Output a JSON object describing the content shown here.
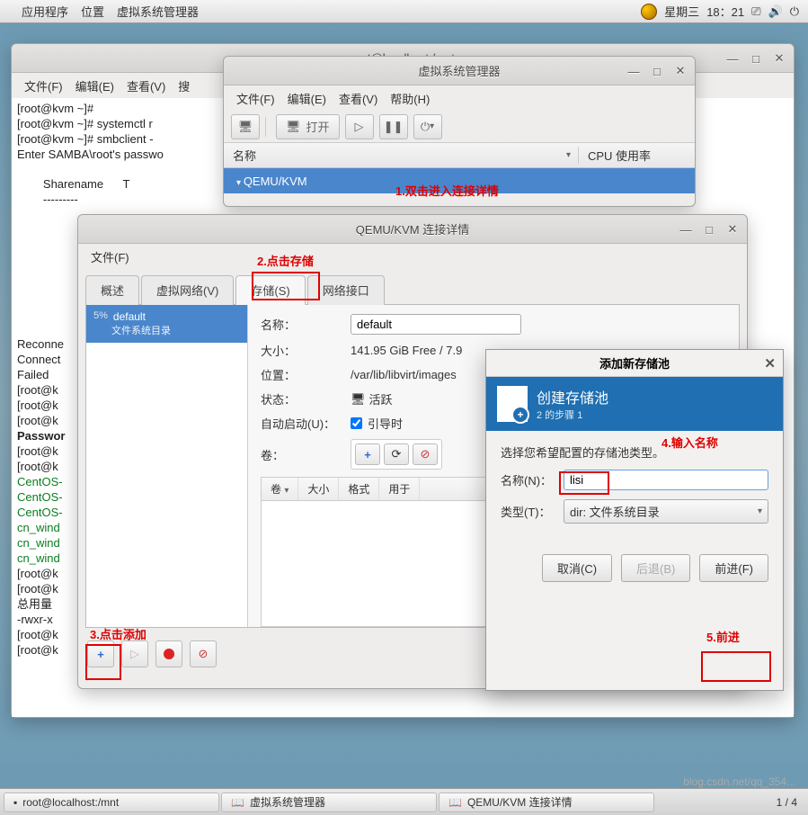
{
  "topbar": {
    "apps": "应用程序",
    "places": "位置",
    "vmm": "虚拟系统管理器",
    "day": "星期三",
    "time": "18：21"
  },
  "terminal": {
    "title": "root@localhost:/mnt",
    "menu": {
      "file": "文件(F)",
      "edit": "编辑(E)",
      "view": "查看(V)",
      "search": "搜"
    },
    "lines": {
      "l1": "[root@kvm ~]#",
      "l2": "[root@kvm ~]# systemctl r",
      "l3": "[root@kvm ~]# smbclient -",
      "l4": "Enter SAMBA\\root's passwo",
      "l5": "        Sharename      T",
      "l6": "        ---------",
      "l7": "Reconne",
      "l8": "Connect",
      "l9": "Failed ",
      "l10": "[root@k",
      "l11": "[root@k",
      "l12": "[root@k",
      "l13": "Passwor",
      "l14": "[root@k",
      "l15": "[root@k",
      "l16": "CentOS-",
      "l17": "CentOS-",
      "l18": "CentOS-",
      "l19": "cn_wind",
      "l20": "cn_wind",
      "l21": "cn_wind",
      "l22": "[root@k",
      "l23": "[root@k",
      "l24": "总用量 ",
      "l25": "-rwxr-x",
      "l26": "[root@k",
      "l27": "[root@k"
    }
  },
  "vmm": {
    "title": "虚拟系统管理器",
    "menu": {
      "file": "文件(F)",
      "edit": "编辑(E)",
      "view": "查看(V)",
      "help": "帮助(H)"
    },
    "open": "打开",
    "col_name": "名称",
    "col_cpu": "CPU 使用率",
    "row0": "QEMU/KVM"
  },
  "cd": {
    "title": "QEMU/KVM 连接详情",
    "menu_file": "文件(F)",
    "tabs": {
      "overview": "概述",
      "vnet": "虚拟网络(V)",
      "storage": "存储(S)",
      "iface": "网络接口"
    },
    "pool": {
      "name": "default",
      "sub": "文件系统目录",
      "pct": "5%"
    },
    "detail": {
      "name_label": "名称：",
      "name_val": "default",
      "size_label": "大小：",
      "size_val": "141.95 GiB Free / 7.9",
      "loc_label": "位置：",
      "loc_val": "/var/lib/libvirt/images",
      "state_label": "状态：",
      "state_val": "活跃",
      "auto_label": "自动启动(U)：",
      "auto_val": "引导时",
      "vol_label": "卷："
    },
    "volcols": {
      "v": "卷",
      "s": "大小",
      "f": "格式",
      "u": "用于"
    }
  },
  "dlg": {
    "title": "添加新存储池",
    "header_big": "创建存储池",
    "header_sub": "2 的步骤 1",
    "hint": "选择您希望配置的存储池类型。",
    "name_label": "名称(N)：",
    "name_val": "lisi",
    "type_label": "类型(T)：",
    "type_val": "dir: 文件系统目录",
    "cancel": "取消(C)",
    "back": "后退(B)",
    "forward": "前进(F)"
  },
  "annot": {
    "a1": "1.双击进入连接详情",
    "a2": "2.点击存储",
    "a3": "3.点击添加",
    "a4": "4.输入名称",
    "a5": "5.前进"
  },
  "taskbar": {
    "t1": "root@localhost:/mnt",
    "t2": "虚拟系统管理器",
    "t3": "QEMU/KVM 连接详情",
    "pages": "1 / 4"
  },
  "watermark": "blog.csdn.net/qq_354..."
}
